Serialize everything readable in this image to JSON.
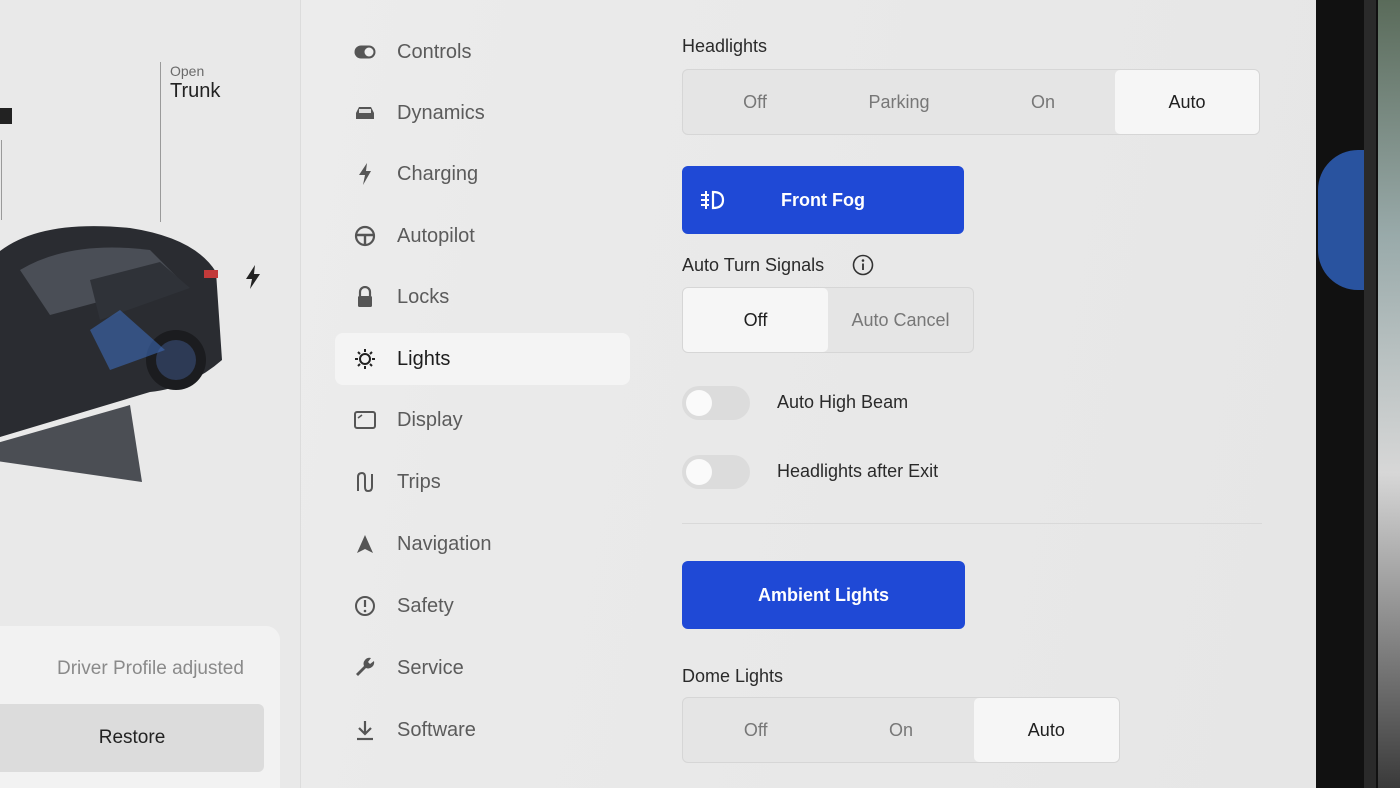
{
  "car_panel": {
    "trunk_status": "Open",
    "trunk_label": "Trunk",
    "notice_text": "Driver Profile adjusted",
    "restore_label": "Restore"
  },
  "nav": {
    "items": [
      {
        "label": "Controls",
        "icon": "toggle-icon"
      },
      {
        "label": "Dynamics",
        "icon": "car-icon"
      },
      {
        "label": "Charging",
        "icon": "bolt-icon"
      },
      {
        "label": "Autopilot",
        "icon": "steering-wheel-icon"
      },
      {
        "label": "Locks",
        "icon": "lock-icon"
      },
      {
        "label": "Lights",
        "icon": "light-bulb-icon",
        "active": true
      },
      {
        "label": "Display",
        "icon": "display-icon"
      },
      {
        "label": "Trips",
        "icon": "trips-icon"
      },
      {
        "label": "Navigation",
        "icon": "navigation-arrow-icon"
      },
      {
        "label": "Safety",
        "icon": "alert-circle-icon"
      },
      {
        "label": "Service",
        "icon": "wrench-icon"
      },
      {
        "label": "Software",
        "icon": "download-icon"
      }
    ]
  },
  "headlights": {
    "label": "Headlights",
    "options": [
      "Off",
      "Parking",
      "On",
      "Auto"
    ],
    "selected": "Auto"
  },
  "front_fog": {
    "label": "Front Fog"
  },
  "turn_signals": {
    "label": "Auto Turn Signals",
    "options": [
      "Off",
      "Auto Cancel"
    ],
    "selected": "Off"
  },
  "auto_high_beam": {
    "label": "Auto High Beam",
    "on": false
  },
  "headlights_after_exit": {
    "label": "Headlights after Exit",
    "on": false
  },
  "ambient_lights": {
    "label": "Ambient Lights"
  },
  "dome_lights": {
    "label": "Dome Lights",
    "options": [
      "Off",
      "On",
      "Auto"
    ],
    "selected": "Auto"
  },
  "colors": {
    "accent_blue": "#1f49d6",
    "background": "#eaeaea",
    "selected_segment": "#f6f6f6"
  }
}
